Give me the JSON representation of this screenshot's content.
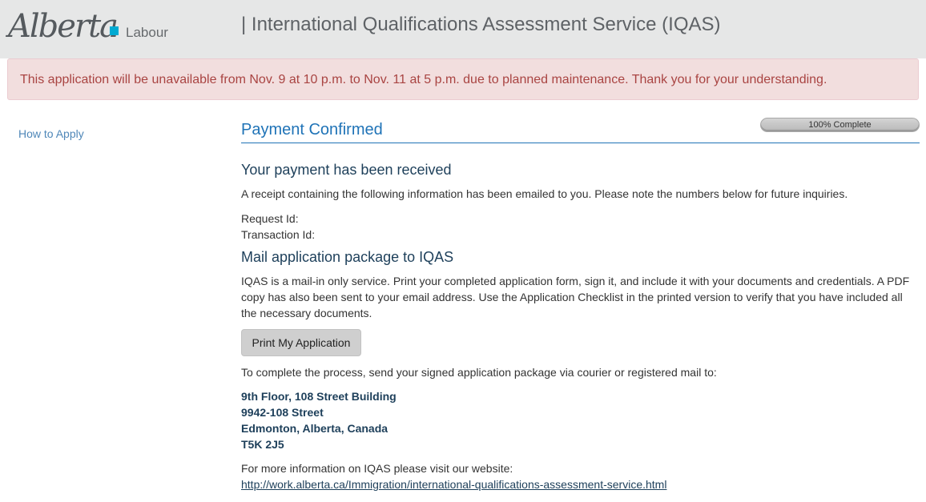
{
  "header": {
    "logo_script": "Alberta",
    "ministry": "Labour",
    "app_title": "| International Qualifications Assessment Service (IQAS)"
  },
  "alert": {
    "message": "This application will be unavailable from Nov. 9 at 10 p.m. to Nov. 11 at 5 p.m. due to planned maintenance. Thank you for your understanding."
  },
  "sidebar": {
    "items": [
      {
        "label": "How to Apply"
      }
    ]
  },
  "main": {
    "title": "Payment Confirmed",
    "progress": {
      "label": "100% Complete",
      "percent": 100
    },
    "payment": {
      "heading": "Your payment has been received",
      "receipt_text": "A receipt containing the following information has been emailed to you. Please note the numbers below for future inquiries.",
      "request_id_label": "Request Id:",
      "transaction_id_label": "Transaction Id:"
    },
    "mail": {
      "heading": "Mail application package to IQAS",
      "instructions": "IQAS is a mail-in only service. Print your completed application form, sign it, and include it with your documents and credentials. A PDF copy has also been sent to your email address. Use the Application Checklist in the printed version to verify that you have included all the necessary documents.",
      "print_button": "Print My Application",
      "complete_text": "To complete the process, send your signed application package via courier or registered mail to:",
      "address": [
        "9th Floor, 108 Street Building",
        "9942-108 Street",
        "Edmonton, Alberta, Canada",
        "T5K 2J5"
      ],
      "more_info_text": "For more information on IQAS please visit our website:",
      "website_link": "http://work.alberta.ca/Immigration/international-qualifications-assessment-service.html"
    }
  },
  "colors": {
    "header_bg": "#e6e7e7",
    "alert_bg": "#f2dede",
    "alert_text": "#a94442",
    "title_blue": "#1f73b7",
    "heading_navy": "#1d3f5a",
    "logo_accent": "#00aad2"
  }
}
